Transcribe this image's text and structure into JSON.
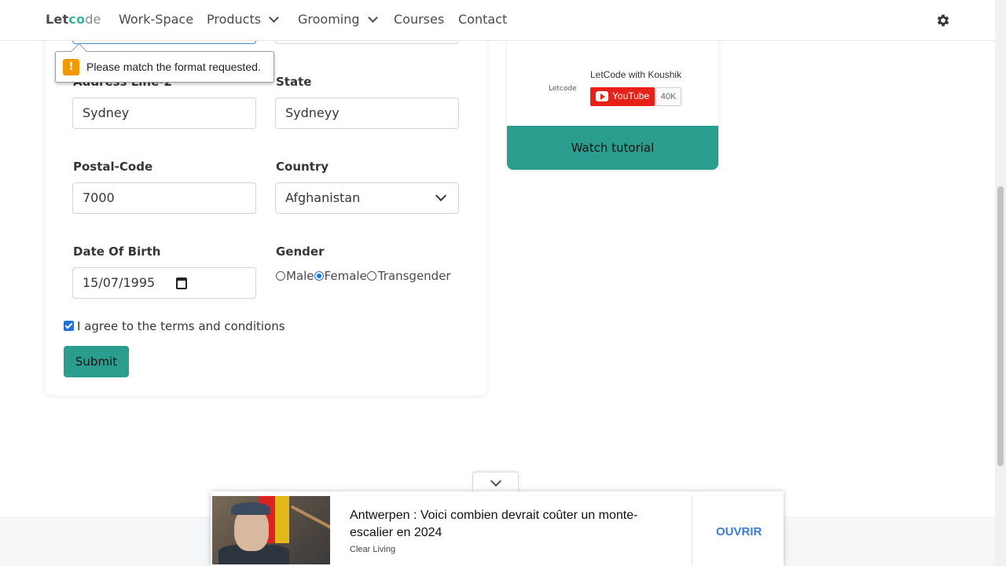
{
  "navbar": {
    "brand": {
      "part1": "Let",
      "part2": "c",
      "part3": "o",
      "part4": "de"
    },
    "items": [
      {
        "label": "Work-Space"
      },
      {
        "label": "Products"
      },
      {
        "label": "Grooming"
      },
      {
        "label": "Courses"
      },
      {
        "label": "Contact"
      }
    ],
    "theme_icon": "gear-icon"
  },
  "form": {
    "tooltip": "Please match the format requested.",
    "address2": {
      "label": "Address Line-2",
      "value": "Sydney"
    },
    "state": {
      "label": "State",
      "value": "Sydneyy"
    },
    "postal": {
      "label": "Postal-Code",
      "value": "7000"
    },
    "country": {
      "label": "Country",
      "value": "Afghanistan"
    },
    "dob": {
      "label": "Date Of Birth",
      "value": "15/07/1995"
    },
    "gender": {
      "label": "Gender",
      "options": [
        "Male",
        "Female",
        "Transgender"
      ],
      "selected": "Female"
    },
    "terms": {
      "label": "I agree to the terms and conditions",
      "checked": true
    },
    "submit": "Submit"
  },
  "side_card": {
    "logo": "Letcode",
    "channel": "LetCode with Koushik",
    "youtube": "YouTube",
    "subscribers": "40K",
    "watch": "Watch tutorial"
  },
  "ad": {
    "headline": "Antwerpen : Voici combien devrait coûter un monte-escalier en 2024",
    "source": "Clear Living",
    "cta": "OUVRIR"
  },
  "colors": {
    "accent": "#2a9d8f",
    "youtube": "#e62117",
    "link": "#3a7bd5",
    "warning": "#f29900"
  }
}
